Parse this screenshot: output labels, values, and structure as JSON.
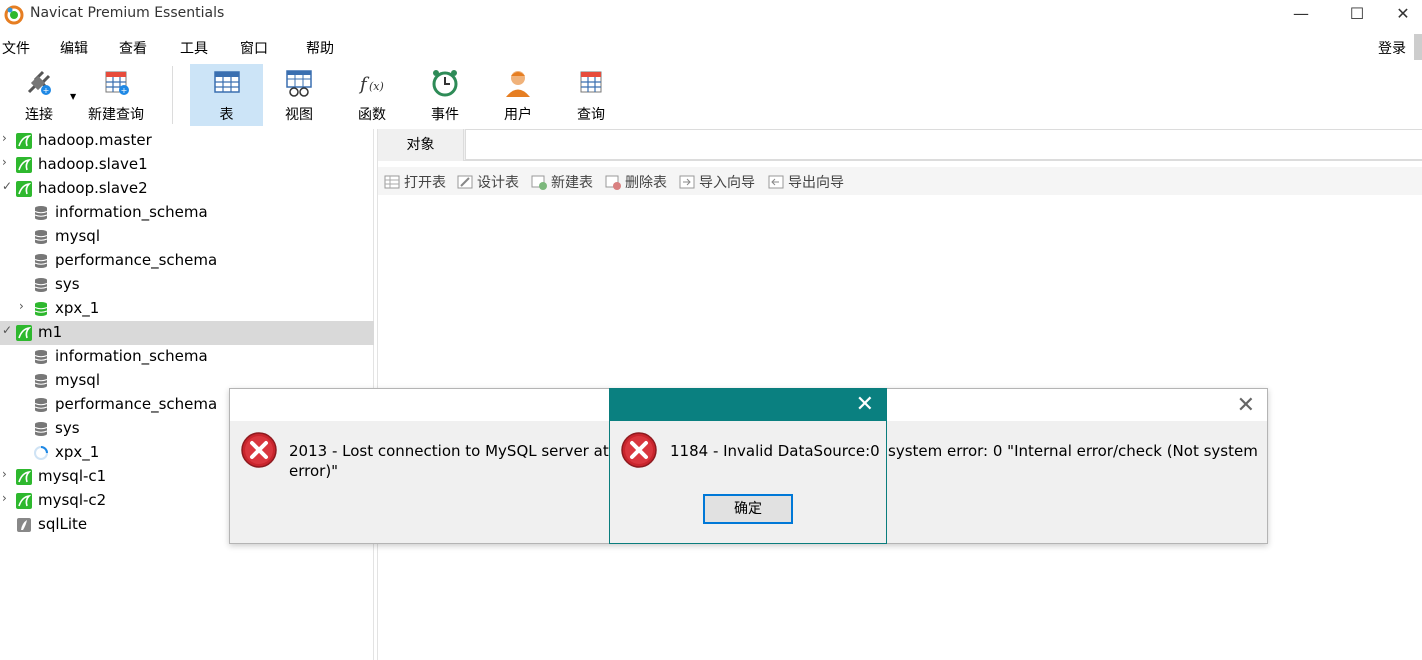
{
  "window": {
    "title": "Navicat Premium Essentials",
    "minimize": "—",
    "maximize": "☐",
    "close": "✕"
  },
  "menu": {
    "items": [
      "文件",
      "编辑",
      "查看",
      "工具",
      "窗口",
      "帮助"
    ],
    "login": "登录"
  },
  "toolbar": {
    "connect": "连接",
    "new_query": "新建查询",
    "table": "表",
    "view": "视图",
    "function": "函数",
    "event": "事件",
    "user": "用户",
    "query": "查询"
  },
  "tree": [
    {
      "label": "hadoop.master",
      "level": 0,
      "expanded": false,
      "icon": "mysql-connection-icon"
    },
    {
      "label": "hadoop.slave1",
      "level": 0,
      "expanded": false,
      "icon": "mysql-connection-icon"
    },
    {
      "label": "hadoop.slave2",
      "level": 0,
      "expanded": true,
      "icon": "mysql-connection-icon"
    },
    {
      "label": "information_schema",
      "level": 1,
      "icon": "database-icon"
    },
    {
      "label": "mysql",
      "level": 1,
      "icon": "database-icon"
    },
    {
      "label": "performance_schema",
      "level": 1,
      "icon": "database-icon"
    },
    {
      "label": "sys",
      "level": 1,
      "icon": "database-icon"
    },
    {
      "label": "xpx_1",
      "level": 1,
      "expanded": false,
      "icon": "database-open-icon"
    },
    {
      "label": "m1",
      "level": 0,
      "expanded": true,
      "icon": "mysql-connection-icon",
      "selected": true
    },
    {
      "label": "information_schema",
      "level": 1,
      "icon": "database-icon"
    },
    {
      "label": "mysql",
      "level": 1,
      "icon": "database-icon"
    },
    {
      "label": "performance_schema",
      "level": 1,
      "icon": "database-icon"
    },
    {
      "label": "sys",
      "level": 1,
      "icon": "database-icon"
    },
    {
      "label": "xpx_1",
      "level": 1,
      "icon": "loading-icon"
    },
    {
      "label": "mysql-c1",
      "level": 0,
      "expanded": false,
      "icon": "mysql-connection-icon"
    },
    {
      "label": "mysql-c2",
      "level": 0,
      "expanded": false,
      "icon": "mysql-connection-icon"
    },
    {
      "label": "sqlLite",
      "level": 0,
      "icon": "sqlite-connection-icon"
    }
  ],
  "tabs": {
    "objects": "对象"
  },
  "objbar": {
    "open_table": "打开表",
    "design_table": "设计表",
    "new_table": "新建表",
    "delete_table": "删除表",
    "import_wizard": "导入向导",
    "export_wizard": "导出向导"
  },
  "dialog1": {
    "message": "2013 - Lost connection to MySQL server at 'r",
    "message_tail": "system error: 0 \"Internal error/check (Not system",
    "message_line2": "error)\"",
    "close": "✕"
  },
  "dialog2": {
    "message": "1184 - Invalid DataSource:0",
    "ok": "确定",
    "close": "✕"
  },
  "colors": {
    "accent": "#0a8080",
    "selection": "#cce4f7",
    "connection": "#2eb82e",
    "error": "#c9252d"
  }
}
